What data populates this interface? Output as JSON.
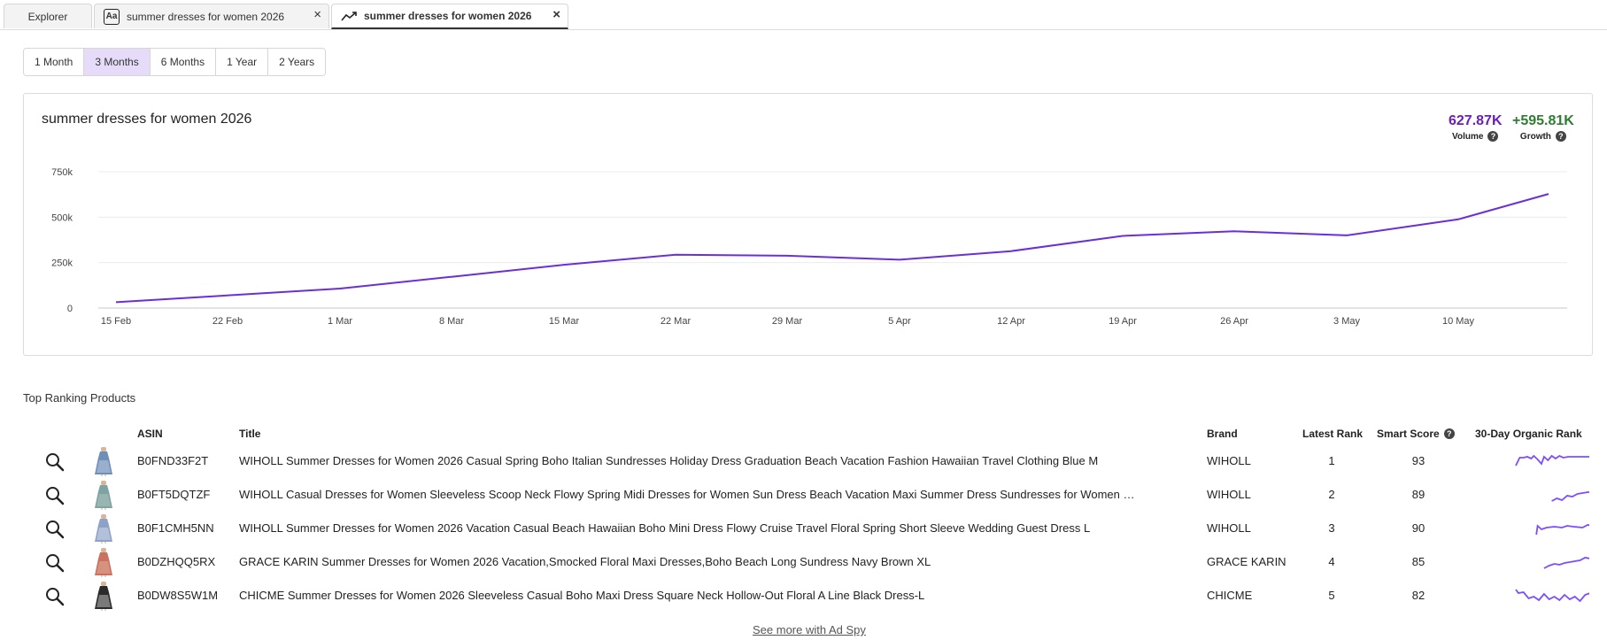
{
  "tabs": [
    {
      "label": "Explorer"
    },
    {
      "label": "summer dresses for women 2026",
      "icon": "text-icon",
      "close": "×"
    },
    {
      "label": "summer dresses for women 2026",
      "icon": "trend-icon",
      "close": "×"
    }
  ],
  "ranges": [
    "1 Month",
    "3 Months",
    "6 Months",
    "1 Year",
    "2 Years"
  ],
  "selected_range": "3 Months",
  "chart_card": {
    "title": "summer dresses for women 2026",
    "volume_value": "627.87K",
    "volume_label": "Volume",
    "growth_value": "+595.81K",
    "growth_label": "Growth",
    "volume_color": "#6a1fb8",
    "growth_color": "#2e7d32",
    "help_icon": "?"
  },
  "chart_data": {
    "type": "line",
    "title": "summer dresses for women 2026",
    "xlabel": "",
    "ylabel": "",
    "x_ticks": [
      "15 Feb",
      "22 Feb",
      "1 Mar",
      "8 Mar",
      "15 Mar",
      "22 Mar",
      "29 Mar",
      "5 Apr",
      "12 Apr",
      "19 Apr",
      "26 Apr",
      "3 May",
      "10 May"
    ],
    "y_ticks": [
      {
        "value": 0,
        "label": "0"
      },
      {
        "value": 250000,
        "label": "250k"
      },
      {
        "value": 500000,
        "label": "500k"
      },
      {
        "value": 750000,
        "label": "750k"
      }
    ],
    "ylim": [
      0,
      750000
    ],
    "grid": true,
    "line_color": "#6a2fd6",
    "series": [
      {
        "values": [
          {
            "x": "15 Feb",
            "y": 32000
          },
          {
            "x": "1 Mar",
            "y": 107000
          },
          {
            "x": "8 Mar",
            "y": 172000
          },
          {
            "x": "15 Mar",
            "y": 238000
          },
          {
            "x": "22 Mar",
            "y": 293000
          },
          {
            "x": "29 Mar",
            "y": 288000
          },
          {
            "x": "5 Apr",
            "y": 266000
          },
          {
            "x": "12 Apr",
            "y": 313000
          },
          {
            "x": "19 Apr",
            "y": 397000
          },
          {
            "x": "26 Apr",
            "y": 422000
          },
          {
            "x": "3 May",
            "y": 400000
          },
          {
            "x": "10 May",
            "y": 488000
          },
          {
            "x": "17 May",
            "y": 628000
          }
        ]
      }
    ]
  },
  "products_section": {
    "title": "Top Ranking Products",
    "headers": {
      "asin": "ASIN",
      "title": "Title",
      "brand": "Brand",
      "latest_rank": "Latest Rank",
      "smart_score": "Smart Score",
      "organic_rank": "30-Day Organic Rank"
    },
    "see_more": "See more with Ad Spy",
    "spark_color": "#7c4dff",
    "rows": [
      {
        "asin": "B0FND33F2T",
        "title": "WIHOLL Summer Dresses for Women 2026 Casual Spring Boho Italian Sundresses Holiday Dress Graduation Beach Vacation Fashion Hawaiian Travel Clothing Blue M",
        "brand": "WIHOLL",
        "rank": "1",
        "score": "93",
        "thumb": [
          "#6f8fb8",
          "#c9d6e8"
        ]
      },
      {
        "asin": "B0FT5DQTZF",
        "title": "WIHOLL Casual Dresses for Women Sleeveless Scoop Neck Flowy Spring Midi Dresses for Women Sun Dress Beach Vacation Maxi Summer Dress Sundresses for Women …",
        "brand": "WIHOLL",
        "rank": "2",
        "score": "89",
        "thumb": [
          "#7fa3a0",
          "#b9ccc8"
        ]
      },
      {
        "asin": "B0F1CMH5NN",
        "title": "WIHOLL Summer Dresses for Women 2026 Vacation Casual Beach Hawaiian Boho Mini Dress Flowy Cruise Travel Floral Spring Short Sleeve Wedding Guest Dress L",
        "brand": "WIHOLL",
        "rank": "3",
        "score": "90",
        "thumb": [
          "#8ea2c8",
          "#dfe4f0"
        ]
      },
      {
        "asin": "B0DZHQQ5RX",
        "title": "GRACE KARIN Summer Dresses for Women 2026 Vacation,Smocked Floral Maxi Dresses,Boho Beach Long Sundress Navy Brown XL",
        "brand": "GRACE KARIN",
        "rank": "4",
        "score": "85",
        "thumb": [
          "#c9735e",
          "#e8b9a8"
        ]
      },
      {
        "asin": "B0DW8S5W1M",
        "title": "CHICME Summer Dresses for Women 2026 Sleeveless Casual Boho Maxi Dress Square Neck Hollow-Out Floral A Line Black Dress-L",
        "brand": "CHICME",
        "rank": "5",
        "score": "82",
        "thumb": [
          "#2b2b2b",
          "#d9d9d9"
        ]
      }
    ]
  }
}
